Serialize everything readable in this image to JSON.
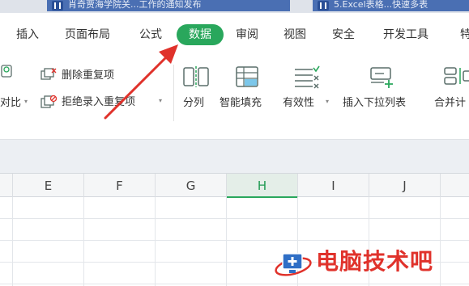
{
  "tabs": {
    "tab1": "肖奇贾海学院关...工作的通知发布",
    "tab2": "5.Excel表格...快速多表"
  },
  "menu": {
    "items": [
      "插入",
      "页面布局",
      "公式",
      "数据",
      "审阅",
      "视图",
      "安全",
      "开发工具",
      "特"
    ],
    "active": "数据"
  },
  "ribbon": {
    "compare": "对比",
    "remove_duplicates": "删除重复项",
    "reject_duplicates": "拒绝录入重复项",
    "split": "分列",
    "smart_fill": "智能填充",
    "validity": "有效性",
    "insert_dropdown": "插入下拉列表",
    "merge": "合并计"
  },
  "grid": {
    "columns": [
      "E",
      "F",
      "G",
      "H",
      "I",
      "J"
    ],
    "selected_column": "H"
  },
  "watermark": {
    "text": "电脑技术吧"
  },
  "colors": {
    "accent": "#29a75c",
    "arrow": "#e0322b",
    "watermark": "#e0322b"
  }
}
